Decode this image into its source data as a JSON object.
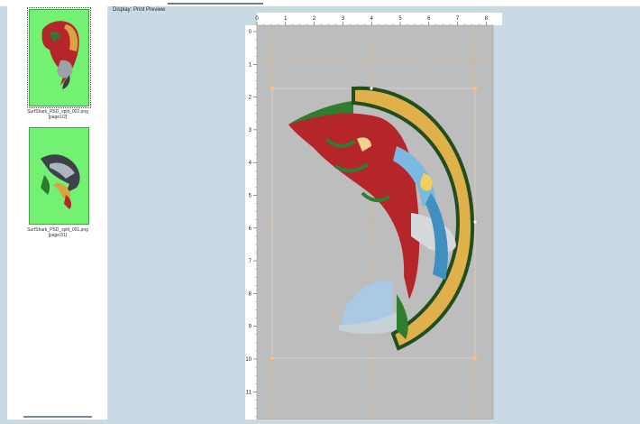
{
  "display": {
    "label": "Display: Print Preview"
  },
  "thumbnails": [
    {
      "caption": "SurfShark_PSD_split_002.png",
      "sub": "[page1/2]"
    },
    {
      "caption": "SurfShark_PSD_split_001.png",
      "sub": "[page2/1]"
    }
  ],
  "ruler": {
    "top_ticks": [
      "0",
      "1",
      "2",
      "3",
      "4",
      "5",
      "6",
      "7",
      "8"
    ],
    "left_ticks": [
      "0",
      "1",
      "2",
      "3",
      "4",
      "5",
      "6",
      "7",
      "8",
      "9",
      "10",
      "11"
    ]
  },
  "colors": {
    "background": "#c8dbe5",
    "page": "#bdbdbd",
    "thumb_bg": "#73f173",
    "handle": "#ffbe7d",
    "guide": "#f2a95e"
  },
  "icons": {
    "handle": "resize-handle-icon"
  }
}
